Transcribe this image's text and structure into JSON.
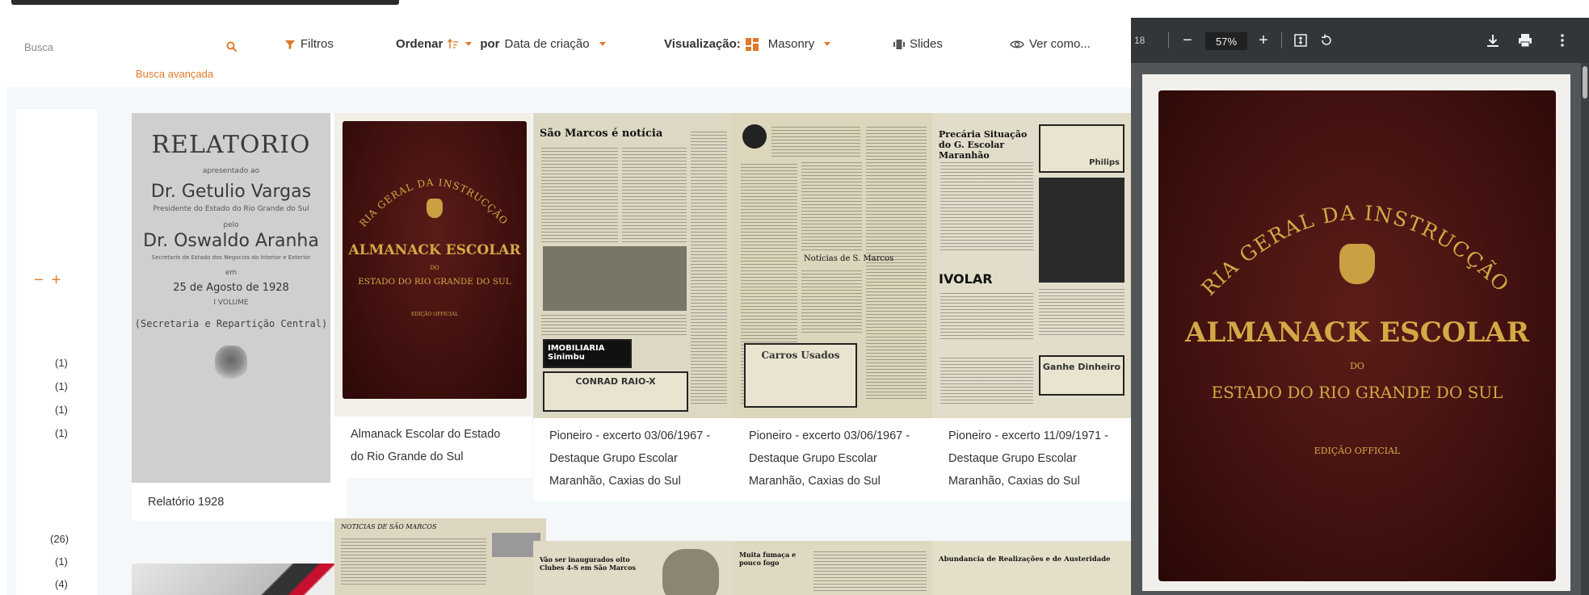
{
  "toolbar": {
    "search_placeholder": "Busca",
    "advanced_search": "Busca avançada",
    "filters_label": "Filtros",
    "sort_label": "Ordenar",
    "sort_by_label": "por",
    "sort_value": "Data de criação",
    "view_label": "Visualização:",
    "view_value": "Masonry",
    "slides_label": "Slides",
    "view_as_label": "Ver como..."
  },
  "sidebar": {
    "zoom_out": "−",
    "zoom_in": "+",
    "counts": [
      "(1)",
      "(1)",
      "(1)",
      "(1)",
      "(26)",
      "(1)",
      "(4)"
    ]
  },
  "items": [
    {
      "title": "Relatório 1928"
    },
    {
      "title": "Almanack Escolar do Estado do Rio Grande do Sul"
    },
    {
      "title": "Pioneiro - excerto 03/06/1967 - Destaque Grupo Escolar Maranhão, Caxias do Sul"
    },
    {
      "title": "Pioneiro - excerto 03/06/1967 - Destaque Grupo Escolar Maranhão, Caxias do Sul"
    },
    {
      "title": "Pioneiro - excerto 11/09/1971 - Destaque Grupo Escolar Maranhão, Caxias do Sul"
    }
  ],
  "relatorio_cover": {
    "heading": "RELATORIO",
    "presented_to": "apresentado ao",
    "name1": "Dr. Getulio Vargas",
    "role1": "Presidente do Estado do Rio Grande do Sul",
    "by": "pelo",
    "name2": "Dr. Oswaldo Aranha",
    "role2": "Secretario de Estado dos Negocios do Interior e Exterior",
    "on": "em",
    "date": "25 de Agosto de 1928",
    "volume": "I VOLUME",
    "section": "(Secretaria e Repartição Central)"
  },
  "almanack_cover": {
    "arc": "DIRECTORIA GERAL DA INSTRUCÇÃO PUBLICA",
    "title": "ALMANACK ESCOLAR",
    "do": "DO",
    "state": "ESTADO DO RIO GRANDE DO SUL",
    "edition": "EDIÇÃO OFFICIAL"
  },
  "newspapers": [
    {
      "headline": "São Marcos é notícia",
      "box": "CONRAD RAIO-X",
      "box2": "IMOBILIARIA Sinimbu"
    },
    {
      "headline": "Notícias de S. Marcos",
      "box": "Carros Usados"
    },
    {
      "headline": "Precária Situação do G. Escolar Maranhão",
      "box": "IVOLAR",
      "box2": "Ganhe Dinheiro",
      "side": "Philips"
    }
  ],
  "row2": [
    {
      "headline": "NOTICIAS DE SÃO MARCOS"
    },
    {
      "headline": "Vão ser inaugurados oito Clubes 4-S em São Marcos"
    },
    {
      "headline": "Muita fumaça e pouco fogo"
    },
    {
      "headline": "Abundancia de Realizações e de Austeridade"
    }
  ],
  "pdf": {
    "page_indicator": "18",
    "zoom": "57%",
    "minus": "−",
    "plus": "+"
  },
  "colors": {
    "accent": "#e0792a",
    "pdf_toolbar": "#323639",
    "pdf_bg": "#525659"
  }
}
